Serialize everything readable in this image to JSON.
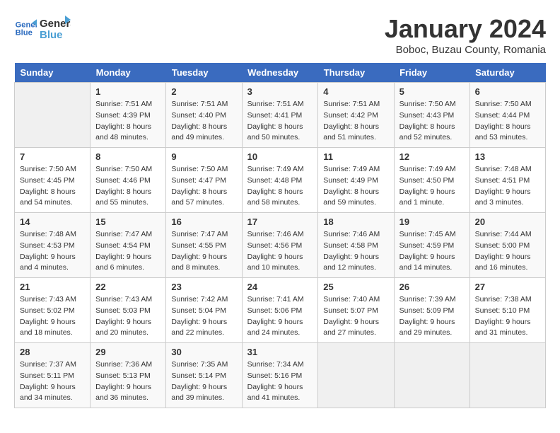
{
  "header": {
    "logo_line1": "General",
    "logo_line2": "Blue",
    "month_title": "January 2024",
    "subtitle": "Boboc, Buzau County, Romania"
  },
  "weekdays": [
    "Sunday",
    "Monday",
    "Tuesday",
    "Wednesday",
    "Thursday",
    "Friday",
    "Saturday"
  ],
  "weeks": [
    [
      {
        "day": "",
        "info": ""
      },
      {
        "day": "1",
        "info": "Sunrise: 7:51 AM\nSunset: 4:39 PM\nDaylight: 8 hours\nand 48 minutes."
      },
      {
        "day": "2",
        "info": "Sunrise: 7:51 AM\nSunset: 4:40 PM\nDaylight: 8 hours\nand 49 minutes."
      },
      {
        "day": "3",
        "info": "Sunrise: 7:51 AM\nSunset: 4:41 PM\nDaylight: 8 hours\nand 50 minutes."
      },
      {
        "day": "4",
        "info": "Sunrise: 7:51 AM\nSunset: 4:42 PM\nDaylight: 8 hours\nand 51 minutes."
      },
      {
        "day": "5",
        "info": "Sunrise: 7:50 AM\nSunset: 4:43 PM\nDaylight: 8 hours\nand 52 minutes."
      },
      {
        "day": "6",
        "info": "Sunrise: 7:50 AM\nSunset: 4:44 PM\nDaylight: 8 hours\nand 53 minutes."
      }
    ],
    [
      {
        "day": "7",
        "info": "Sunrise: 7:50 AM\nSunset: 4:45 PM\nDaylight: 8 hours\nand 54 minutes."
      },
      {
        "day": "8",
        "info": "Sunrise: 7:50 AM\nSunset: 4:46 PM\nDaylight: 8 hours\nand 55 minutes."
      },
      {
        "day": "9",
        "info": "Sunrise: 7:50 AM\nSunset: 4:47 PM\nDaylight: 8 hours\nand 57 minutes."
      },
      {
        "day": "10",
        "info": "Sunrise: 7:49 AM\nSunset: 4:48 PM\nDaylight: 8 hours\nand 58 minutes."
      },
      {
        "day": "11",
        "info": "Sunrise: 7:49 AM\nSunset: 4:49 PM\nDaylight: 8 hours\nand 59 minutes."
      },
      {
        "day": "12",
        "info": "Sunrise: 7:49 AM\nSunset: 4:50 PM\nDaylight: 9 hours\nand 1 minute."
      },
      {
        "day": "13",
        "info": "Sunrise: 7:48 AM\nSunset: 4:51 PM\nDaylight: 9 hours\nand 3 minutes."
      }
    ],
    [
      {
        "day": "14",
        "info": "Sunrise: 7:48 AM\nSunset: 4:53 PM\nDaylight: 9 hours\nand 4 minutes."
      },
      {
        "day": "15",
        "info": "Sunrise: 7:47 AM\nSunset: 4:54 PM\nDaylight: 9 hours\nand 6 minutes."
      },
      {
        "day": "16",
        "info": "Sunrise: 7:47 AM\nSunset: 4:55 PM\nDaylight: 9 hours\nand 8 minutes."
      },
      {
        "day": "17",
        "info": "Sunrise: 7:46 AM\nSunset: 4:56 PM\nDaylight: 9 hours\nand 10 minutes."
      },
      {
        "day": "18",
        "info": "Sunrise: 7:46 AM\nSunset: 4:58 PM\nDaylight: 9 hours\nand 12 minutes."
      },
      {
        "day": "19",
        "info": "Sunrise: 7:45 AM\nSunset: 4:59 PM\nDaylight: 9 hours\nand 14 minutes."
      },
      {
        "day": "20",
        "info": "Sunrise: 7:44 AM\nSunset: 5:00 PM\nDaylight: 9 hours\nand 16 minutes."
      }
    ],
    [
      {
        "day": "21",
        "info": "Sunrise: 7:43 AM\nSunset: 5:02 PM\nDaylight: 9 hours\nand 18 minutes."
      },
      {
        "day": "22",
        "info": "Sunrise: 7:43 AM\nSunset: 5:03 PM\nDaylight: 9 hours\nand 20 minutes."
      },
      {
        "day": "23",
        "info": "Sunrise: 7:42 AM\nSunset: 5:04 PM\nDaylight: 9 hours\nand 22 minutes."
      },
      {
        "day": "24",
        "info": "Sunrise: 7:41 AM\nSunset: 5:06 PM\nDaylight: 9 hours\nand 24 minutes."
      },
      {
        "day": "25",
        "info": "Sunrise: 7:40 AM\nSunset: 5:07 PM\nDaylight: 9 hours\nand 27 minutes."
      },
      {
        "day": "26",
        "info": "Sunrise: 7:39 AM\nSunset: 5:09 PM\nDaylight: 9 hours\nand 29 minutes."
      },
      {
        "day": "27",
        "info": "Sunrise: 7:38 AM\nSunset: 5:10 PM\nDaylight: 9 hours\nand 31 minutes."
      }
    ],
    [
      {
        "day": "28",
        "info": "Sunrise: 7:37 AM\nSunset: 5:11 PM\nDaylight: 9 hours\nand 34 minutes."
      },
      {
        "day": "29",
        "info": "Sunrise: 7:36 AM\nSunset: 5:13 PM\nDaylight: 9 hours\nand 36 minutes."
      },
      {
        "day": "30",
        "info": "Sunrise: 7:35 AM\nSunset: 5:14 PM\nDaylight: 9 hours\nand 39 minutes."
      },
      {
        "day": "31",
        "info": "Sunrise: 7:34 AM\nSunset: 5:16 PM\nDaylight: 9 hours\nand 41 minutes."
      },
      {
        "day": "",
        "info": ""
      },
      {
        "day": "",
        "info": ""
      },
      {
        "day": "",
        "info": ""
      }
    ]
  ]
}
